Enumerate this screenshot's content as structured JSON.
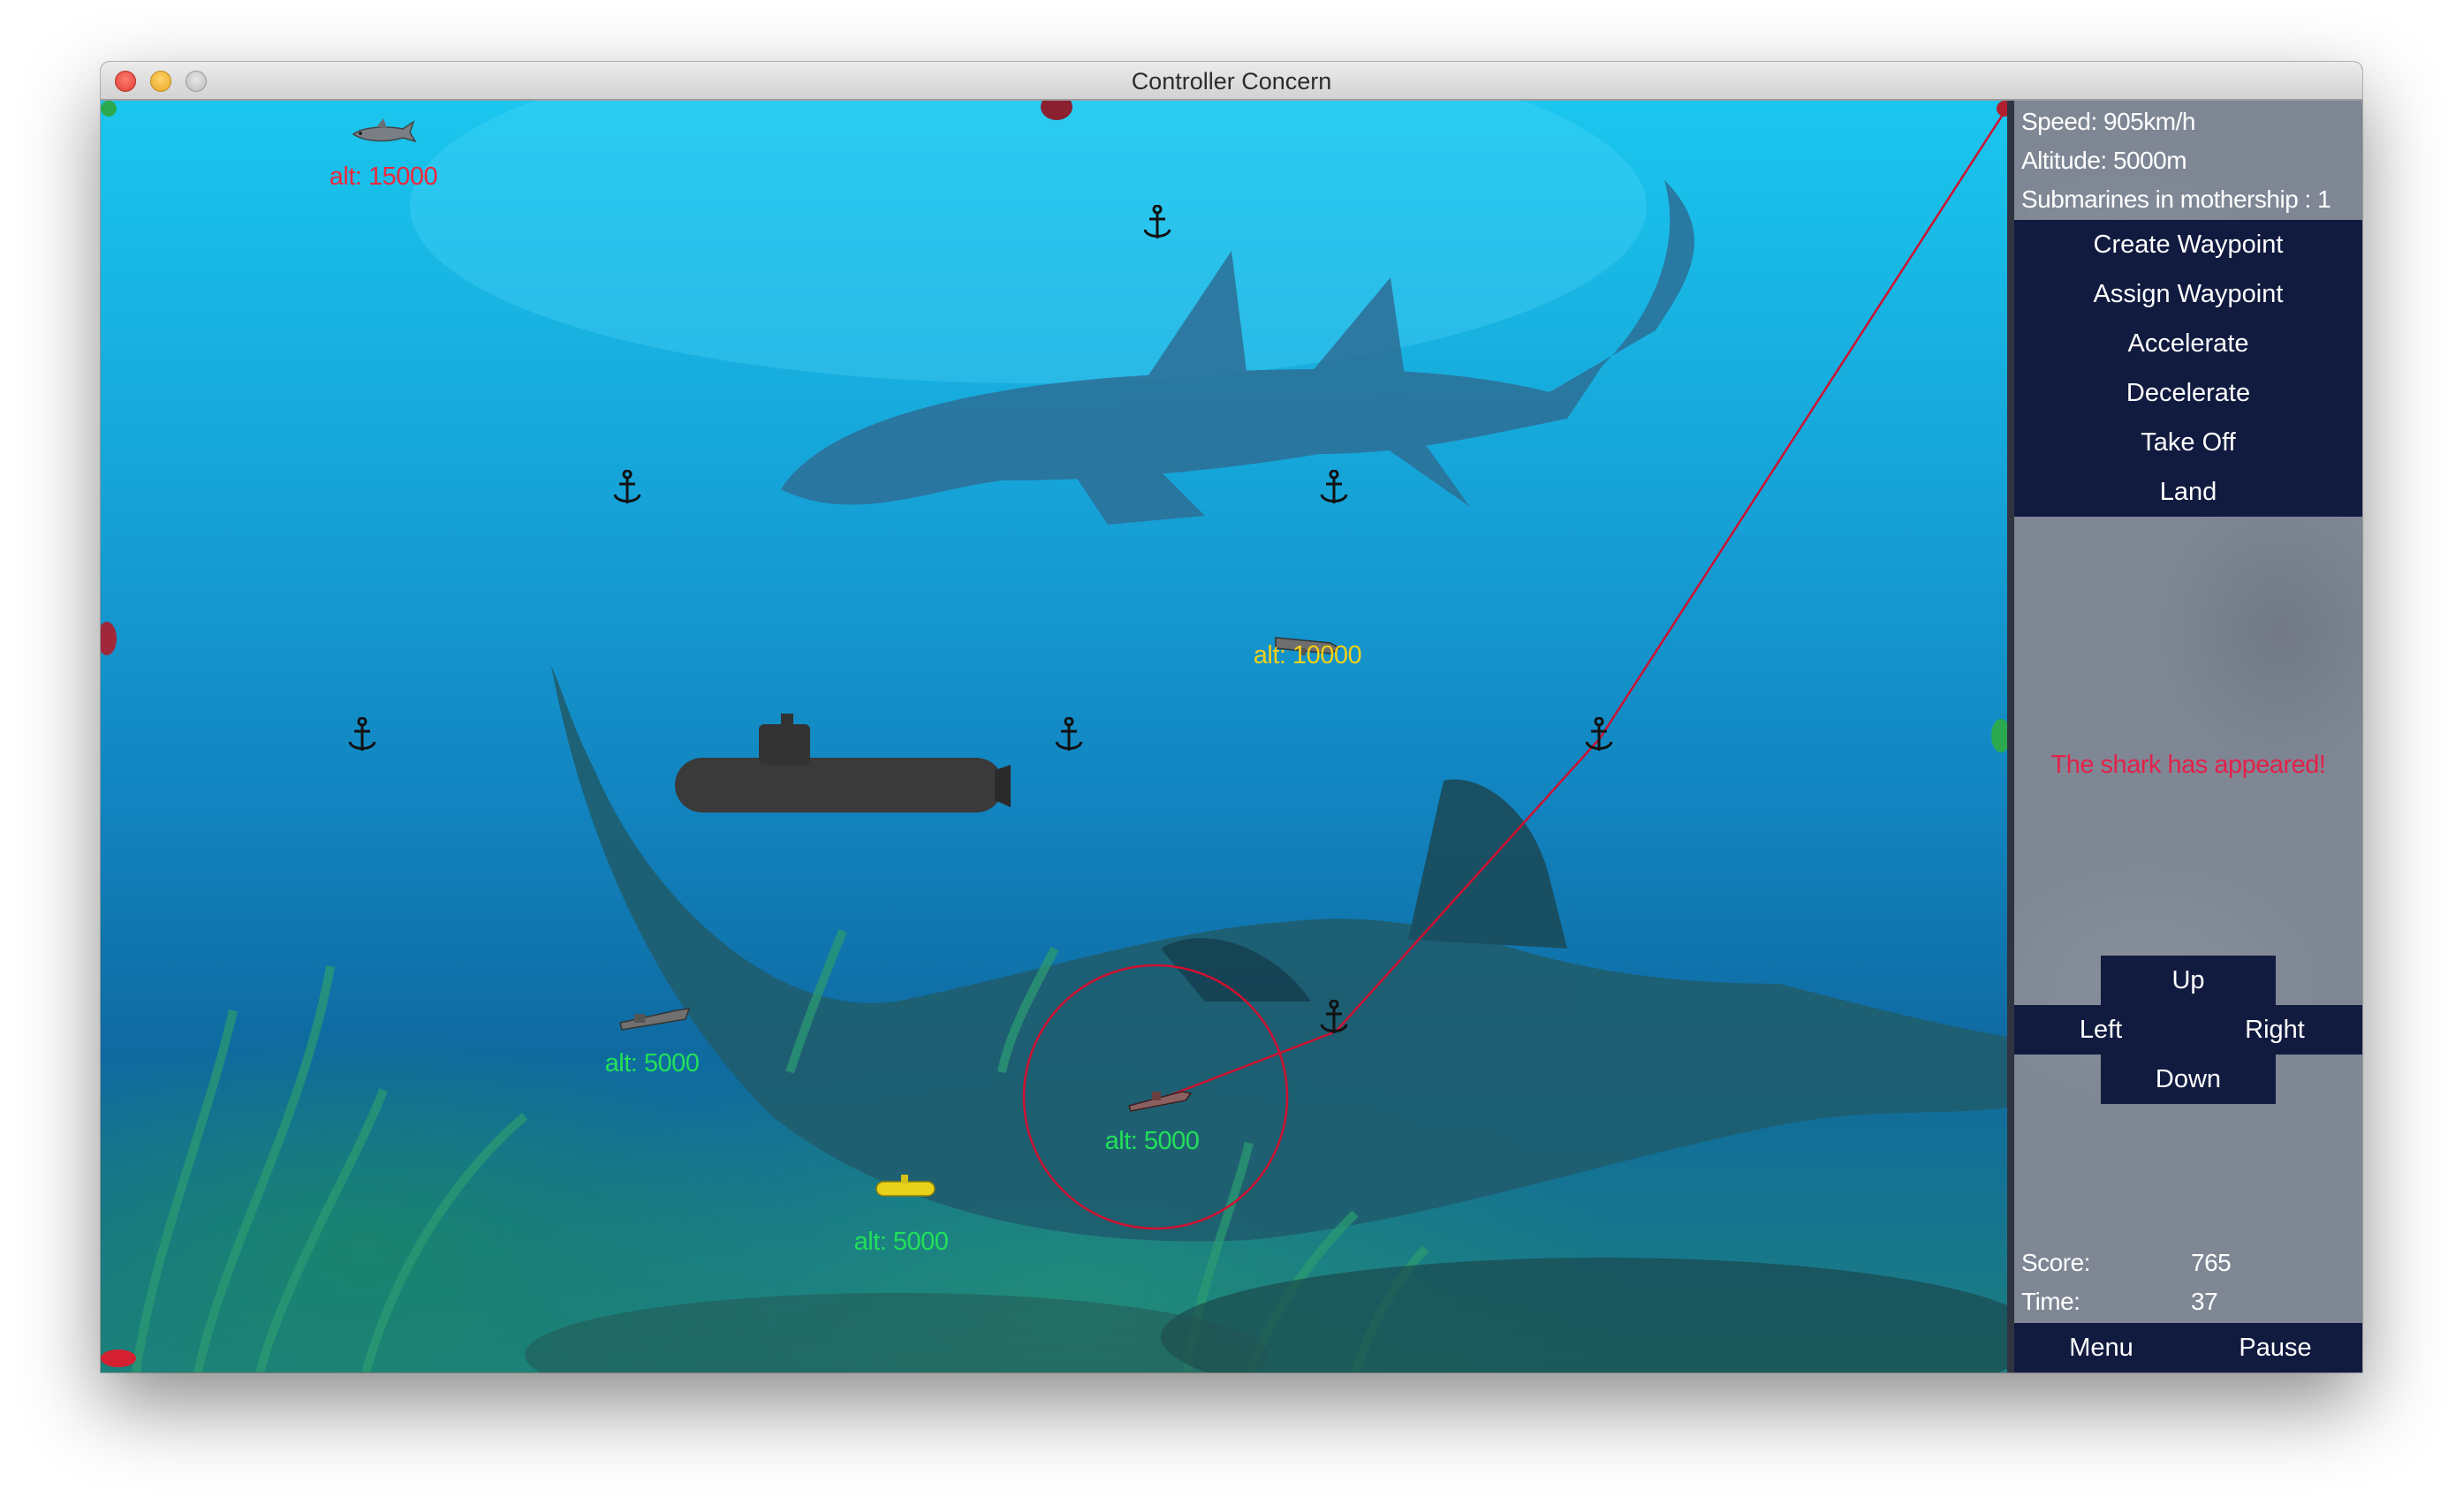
{
  "window": {
    "title": "Controller Concern"
  },
  "game_area": {
    "units": [
      {
        "name": "shark-unit",
        "altitude_label": "alt: 15000",
        "label_color": "#f0273a"
      },
      {
        "name": "torpedo-unit",
        "altitude_label": "alt: 10000",
        "label_color": "#f3d018"
      },
      {
        "name": "gray-sub-left",
        "altitude_label": "alt: 5000",
        "label_color": "#22e05a"
      },
      {
        "name": "selected-sub",
        "altitude_label": "alt: 5000",
        "label_color": "#22e05a"
      },
      {
        "name": "yellow-sub",
        "altitude_label": "alt: 5000",
        "label_color": "#22e05a"
      }
    ],
    "route_color": "#d01030",
    "selection_color": "#d01030"
  },
  "panel": {
    "speed": "Speed: 905km/h",
    "altitude": "Altitude: 5000m",
    "submarines": "Submarines in mothership : 1",
    "menu": {
      "create_waypoint": "Create Waypoint",
      "assign_waypoint": "Assign Waypoint",
      "accelerate": "Accelerate",
      "decelerate": "Decelerate",
      "take_off": "Take Off",
      "land": "Land"
    },
    "message": "The shark has appeared!",
    "controls": {
      "up": "Up",
      "left": "Left",
      "right": "Right",
      "down": "Down"
    },
    "score_label": "Score:",
    "score_value": "765",
    "time_label": "Time:",
    "time_value": "37",
    "bottom": {
      "menu": "Menu",
      "pause": "Pause"
    }
  }
}
